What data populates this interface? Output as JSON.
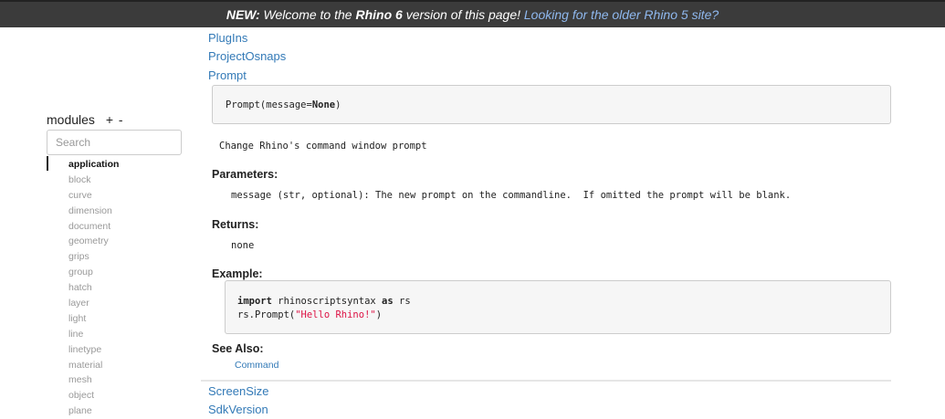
{
  "banner": {
    "new_label": "NEW:",
    "text_a": " Welcome to the ",
    "rhino_label": "Rhino 6",
    "text_b": " version of this page! ",
    "link": "Looking for the older Rhino 5 site?"
  },
  "sidebar": {
    "title": "modules",
    "plus": "+",
    "minus": "-",
    "search_placeholder": "Search",
    "items": [
      "application",
      "block",
      "curve",
      "dimension",
      "document",
      "geometry",
      "grips",
      "group",
      "hatch",
      "layer",
      "light",
      "line",
      "linetype",
      "material",
      "mesh",
      "object",
      "plane"
    ],
    "active_index": 0
  },
  "main": {
    "links_above": [
      "PlugIns",
      "ProjectOsnaps",
      "Prompt"
    ],
    "signature": "Prompt(message=None)",
    "signature_pre": "Prompt(message=",
    "signature_kw": "None",
    "signature_post": ")",
    "description": "Change Rhino's command window prompt",
    "parameters_label": "Parameters:",
    "parameter_text": "message (str, optional): The new prompt on the commandline.  If omitted the prompt will be blank.",
    "returns_label": "Returns:",
    "returns_text": "none",
    "example_label": "Example:",
    "code": {
      "kw_import": "import",
      "line1_rest": " rhinoscriptsyntax ",
      "kw_as": "as",
      "line1_end": " rs",
      "line2_pre": "rs.Prompt(",
      "line2_str": "\"Hello Rhino!\"",
      "line2_post": ")"
    },
    "see_also_label": "See Also:",
    "see_also": [
      "Command"
    ],
    "links_below": [
      "ScreenSize",
      "SdkVersion"
    ]
  },
  "colors": {
    "link": "#337ab7",
    "banner_bg": "#3b3b3b",
    "string": "#dd1144"
  }
}
